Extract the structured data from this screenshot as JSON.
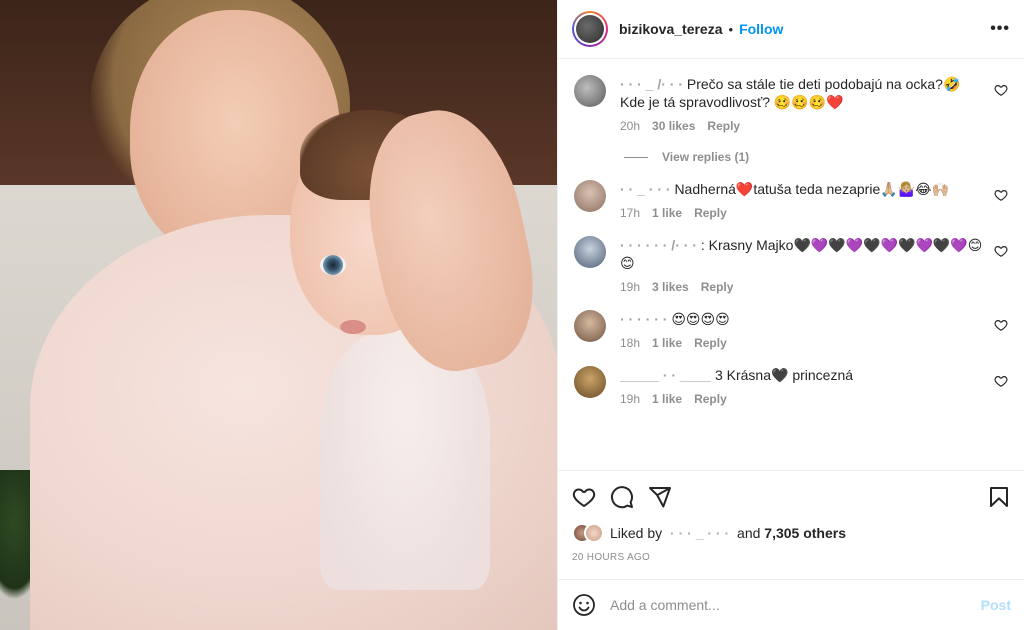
{
  "post": {
    "username": "bizikova_tereza",
    "separator": "•",
    "follow_label": "Follow",
    "more_label": "•••"
  },
  "comments": [
    {
      "user": "·  ·  ·  _ /·  ·  ·",
      "text": "Prečo sa stále tie deti podobajú na ocka?🤣 Kde je tá spravodlivosť? 🥴🥴🥴❤️",
      "time": "20h",
      "likes": "30 likes",
      "reply": "Reply",
      "view_replies": "View replies (1)"
    },
    {
      "user": "·  ·  _  ·  ·  ·",
      "text": "Nadherná❤️tatuša teda nezaprie🙏🏼🤷🏼‍♀️😂🙌🏼",
      "time": "17h",
      "likes": "1 like",
      "reply": "Reply"
    },
    {
      "user": "·  ·  ·  ·  ·  ·  /·  ·  ·",
      "text": ": Krasny Majko🖤💜🖤💜🖤💜🖤💜🖤💜😊😊",
      "time": "19h",
      "likes": "3 likes",
      "reply": "Reply"
    },
    {
      "user": "·  ·  ·  ·  ·  ·",
      "text": "😍😍😍😍",
      "time": "18h",
      "likes": "1 like",
      "reply": "Reply"
    },
    {
      "user": "_____  ·  · ____",
      "text": "3 Krásna🖤 princezná",
      "time": "19h",
      "likes": "1 like",
      "reply": "Reply"
    }
  ],
  "likes_row": {
    "prefix": "Liked by",
    "blurred_user": "·  ·  ·  _  ·  ·  ·",
    "conjunction": "and",
    "others": "7,305 others"
  },
  "timestamp": "20 HOURS AGO",
  "add_comment": {
    "placeholder": "Add a comment...",
    "post_label": "Post"
  },
  "colors": {
    "accent": "#0095f6",
    "post_disabled": "#b2dffc",
    "muted": "#8e8e8e",
    "text": "#262626"
  },
  "icons": [
    "heart-icon",
    "comment-icon",
    "share-icon",
    "bookmark-icon",
    "emoji-icon",
    "more-icon"
  ]
}
